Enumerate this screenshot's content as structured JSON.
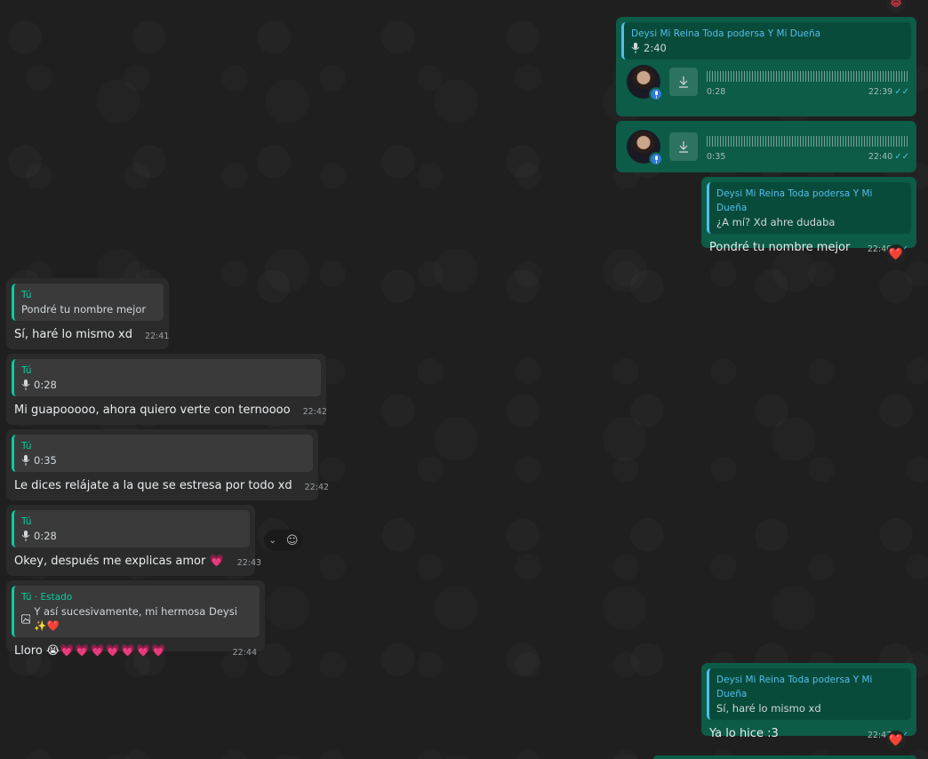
{
  "colors": {
    "outgoing": "#0c5c47",
    "incoming": "#2b2b2b",
    "accent_out": "#53bdeb",
    "accent_in": "#06cf9c"
  },
  "icons": {
    "mic": "mic-icon",
    "download": "download-icon",
    "read": "double-check-icon",
    "image": "image-icon",
    "chevron": "chevron-down-icon",
    "emoji": "emoji-icon"
  },
  "top_reaction": "😂",
  "messages": [
    {
      "quote_author": "Deysi Mi Reina Toda podersa Y Mi Dueña",
      "quote_text": "2:40",
      "voice_duration": "0:28",
      "time": "22:39"
    },
    {
      "voice_duration": "0:35",
      "time": "22:40"
    },
    {
      "quote_author": "Deysi Mi Reina Toda podersa Y Mi Dueña",
      "quote_text": "¿A mí? Xd ahre dudaba",
      "text": "Pondré tu nombre mejor",
      "time": "22:40",
      "reaction": "❤️"
    },
    {
      "quote_author": "Tú",
      "quote_text": "Pondré tu nombre mejor",
      "text": "Sí, haré lo mismo xd",
      "time": "22:41"
    },
    {
      "quote_author": "Tú",
      "quote_text": "0:28",
      "text": "Mi guapooooo, ahora quiero verte con ternoooo",
      "time": "22:42"
    },
    {
      "quote_author": "Tú",
      "quote_text": "0:35",
      "text": "Le dices relájate a la que se estresa por todo xd",
      "time": "22:42"
    },
    {
      "quote_author": "Tú",
      "quote_text": "0:28",
      "text": "Okey, después me explicas amor",
      "text_emoji": "💗",
      "time": "22:43"
    },
    {
      "quote_author": "Tú · Estado",
      "quote_text": "Y así sucesivamente, mi hermosa Deysi ✨❤️",
      "text": "Lloro 😭",
      "text_emoji": "💗💗💗💗💗💗💗",
      "time": "22:44"
    },
    {
      "quote_author": "Deysi Mi Reina Toda podersa Y Mi Dueña",
      "quote_text": "Sí, haré lo mismo xd",
      "text": "Ya lo hice :3",
      "time": "22:47",
      "reaction": "❤️"
    }
  ]
}
